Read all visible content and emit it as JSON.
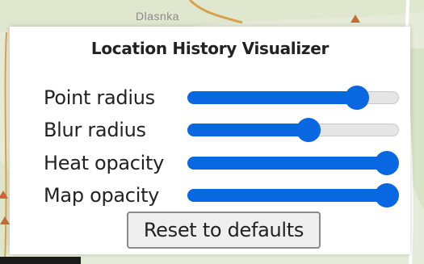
{
  "map": {
    "place_label": "Dlasnka",
    "road_color": "#d9a24a",
    "peak_color": "#c8693a",
    "land_color": "#e6ebd9"
  },
  "panel": {
    "title": "Location History Visualizer",
    "accent_color": "#0a67e2",
    "sliders": [
      {
        "label": "Point radius",
        "value_fraction": 0.84
      },
      {
        "label": "Blur radius",
        "value_fraction": 0.58
      },
      {
        "label": "Heat opacity",
        "value_fraction": 1.0
      },
      {
        "label": "Map opacity",
        "value_fraction": 1.0
      }
    ],
    "reset_label": "Reset to defaults"
  }
}
